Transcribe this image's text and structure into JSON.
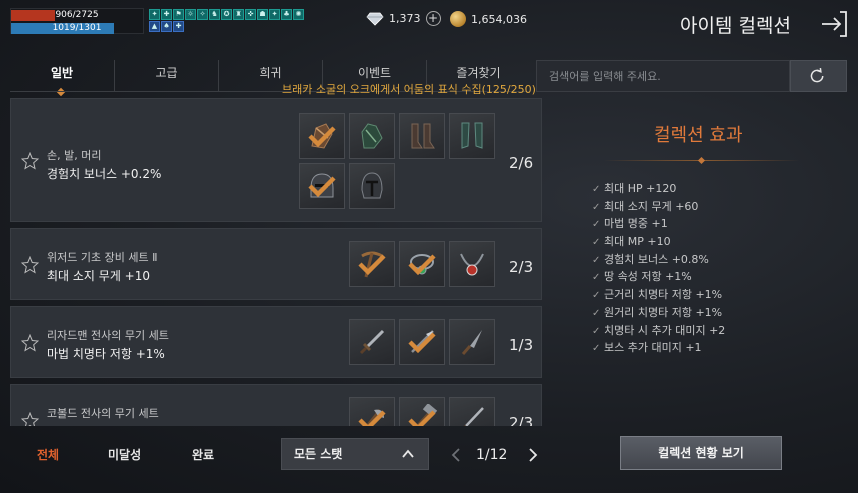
{
  "hud": {
    "hp_text": "906/2725",
    "hp_fraction": 0.33,
    "mp_text": "1019/1301",
    "mp_fraction": 0.78
  },
  "currency": {
    "diamonds": "1,373",
    "gold": "1,654,036"
  },
  "header": {
    "title": "아이템 컬렉션"
  },
  "tabs": [
    {
      "label": "일반",
      "active": true
    },
    {
      "label": "고급",
      "active": false
    },
    {
      "label": "희귀",
      "active": false
    },
    {
      "label": "이벤트",
      "active": false
    },
    {
      "label": "즐겨찾기",
      "active": false
    }
  ],
  "search": {
    "placeholder": "검색어를 입력해 주세요."
  },
  "notice": "브래카 소굴의 오크에게서 어둠의 표식 수집(125/250)",
  "collections": [
    {
      "name": "손, 발, 머리",
      "bonus": "경험치 보너스 +0.2%",
      "count": "2/6"
    },
    {
      "name": "위저드 기초 장비 세트 Ⅱ",
      "bonus": "최대 소지 무게 +10",
      "count": "2/3"
    },
    {
      "name": "리자드맨 전사의 무기 세트",
      "bonus": "마법 치명타 저항 +1%",
      "count": "1/3"
    },
    {
      "name": "코볼드 전사의 무기 세트",
      "bonus": "",
      "count": "2/3"
    }
  ],
  "effects": {
    "title": "컬렉션 효과",
    "items": [
      "최대 HP +120",
      "최대 소지 무게 +60",
      "마법 명중 +1",
      "최대 MP +10",
      "경험치 보너스 +0.8%",
      "땅 속성 저항 +1%",
      "근거리 치명타 저항 +1%",
      "원거리 치명타 저항 +1%",
      "치명타 시 추가 대미지 +2",
      "보스 추가 대미지 +1"
    ]
  },
  "filters": {
    "all": "전체",
    "incomplete": "미달성",
    "complete": "완료"
  },
  "stat_dropdown": {
    "selected": "모든 스탯"
  },
  "pagination": {
    "text": "1/12"
  },
  "status_button": "컬렉션 현황 보기",
  "colors": {
    "accent": "#e0622e",
    "notice": "#e1a83e",
    "check": "#d58a3c"
  }
}
